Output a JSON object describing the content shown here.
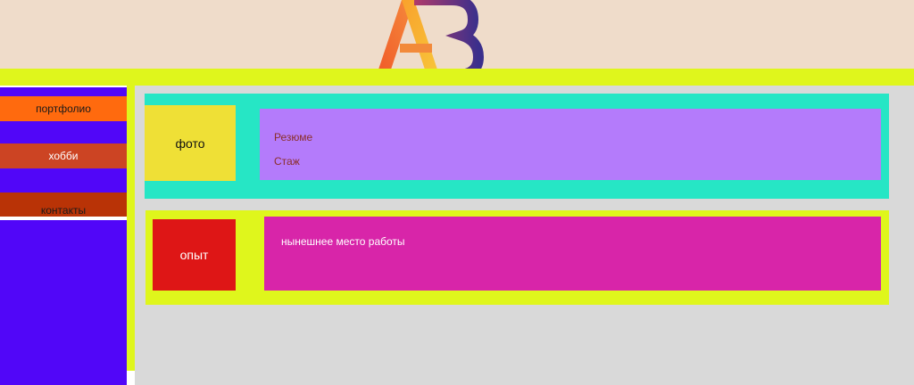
{
  "header": {
    "logo_icon": "ab-logo-icon"
  },
  "sidebar": {
    "items": [
      {
        "label": "портфолио"
      },
      {
        "label": "хобби"
      },
      {
        "label": "контакты"
      }
    ]
  },
  "profile": {
    "photo_label": "фото",
    "links": [
      "Резюме",
      "Стаж"
    ]
  },
  "experience": {
    "label": "опыт",
    "current_job": "нынешнее место работы"
  },
  "colors": {
    "header_bg": "#efdcca",
    "accent_yellow": "#dff61c",
    "sidebar_bg": "#5106f8",
    "card_teal": "#26e6c5",
    "photo_yellow": "#efe036",
    "resume_purple": "#b47bfb",
    "experience_red": "#de1616",
    "job_magenta": "#d825a9",
    "main_bg": "#d9d9d9"
  }
}
